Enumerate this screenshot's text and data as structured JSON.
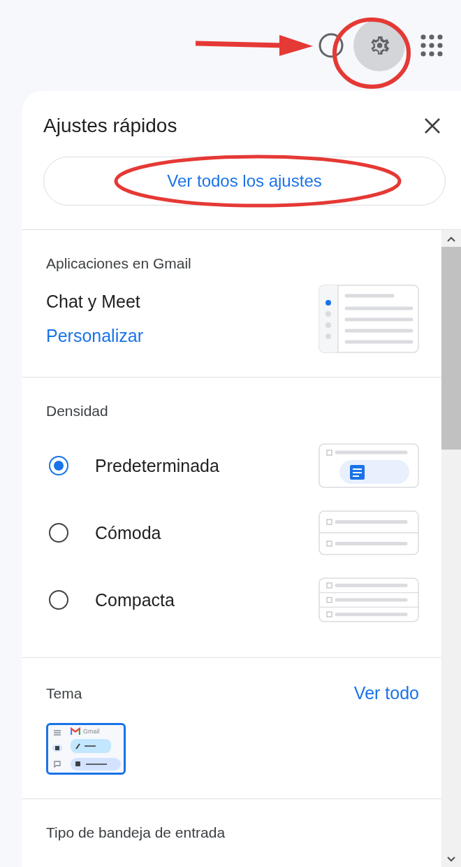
{
  "topbar": {
    "icons": [
      {
        "kind": "help",
        "selected": false
      },
      {
        "kind": "settings",
        "selected": true
      },
      {
        "kind": "apps",
        "selected": false
      }
    ]
  },
  "panel": {
    "title": "Ajustes rápidos",
    "all_settings_button": "Ver todos los ajustes",
    "apps_section": {
      "heading": "Aplicaciones en Gmail",
      "label": "Chat y Meet",
      "link": "Personalizar"
    },
    "density": {
      "heading": "Densidad",
      "options": [
        {
          "label": "Predeterminada",
          "selected": true,
          "kind": "default"
        },
        {
          "label": "Cómoda",
          "selected": false,
          "kind": "comfortable"
        },
        {
          "label": "Compacta",
          "selected": false,
          "kind": "compact"
        }
      ]
    },
    "theme": {
      "heading": "Tema",
      "link": "Ver todo",
      "preview_label": "Gmail"
    },
    "inbox_type": {
      "heading": "Tipo de bandeja de entrada"
    }
  }
}
